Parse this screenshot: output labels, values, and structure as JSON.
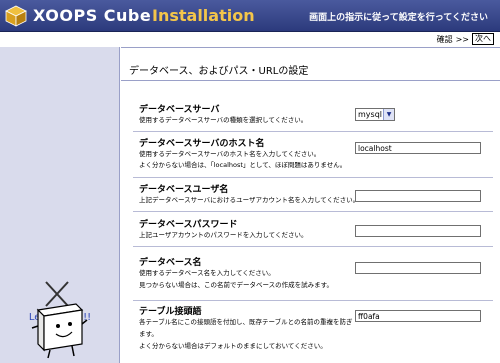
{
  "header": {
    "logo_text": "XOOPS Cube",
    "title": "Installation",
    "note": "画面上の指示に従って設定を行ってください"
  },
  "nav": {
    "confirm": "確認",
    "sep": ">>",
    "next": "次へ"
  },
  "sidebar": {
    "lets_start": "Let's Start !!"
  },
  "main": {
    "section_title": "データベース、およびパス・URLの設定",
    "rows": [
      {
        "label": "データベースサーバ",
        "desc": [
          "使用するデータベースサーバの種類を選択してください。"
        ],
        "value": "mysql"
      },
      {
        "label": "データベースサーバのホスト名",
        "desc": [
          "使用するデータベースサーバのホスト名を入力してください。",
          "よく分からない場合は、「localhost」として、ほぼ問題はありません。"
        ],
        "value": "localhost"
      },
      {
        "label": "データベースユーザ名",
        "desc": [
          "上記データベースサーバにおけるユーザアカウント名を入力してください。"
        ],
        "value": ""
      },
      {
        "label": "データベースパスワード",
        "desc": [
          "上記ユーザアカウントのパスワードを入力してください。"
        ],
        "value": ""
      },
      {
        "label": "データベース名",
        "desc": [
          "使用するデータベース名を入力してください。",
          "見つからない場合は、この名前でデータベースの作成を試みます。"
        ],
        "value": ""
      },
      {
        "label": "テーブル接頭語",
        "desc": [
          "各テーブル名にこの接頭語を付加し、既存テーブルとの名前の重複を防ぎ",
          "ます。",
          "よく分からない場合はデフォルトのままにしておいてください。"
        ],
        "value": "ff0afa"
      }
    ]
  },
  "colors": {
    "header_bg": "#2c3a7c",
    "title_accent": "#f3c54a",
    "sidebar_bg": "#d9dbec",
    "lets_start": "#2f49b8"
  }
}
